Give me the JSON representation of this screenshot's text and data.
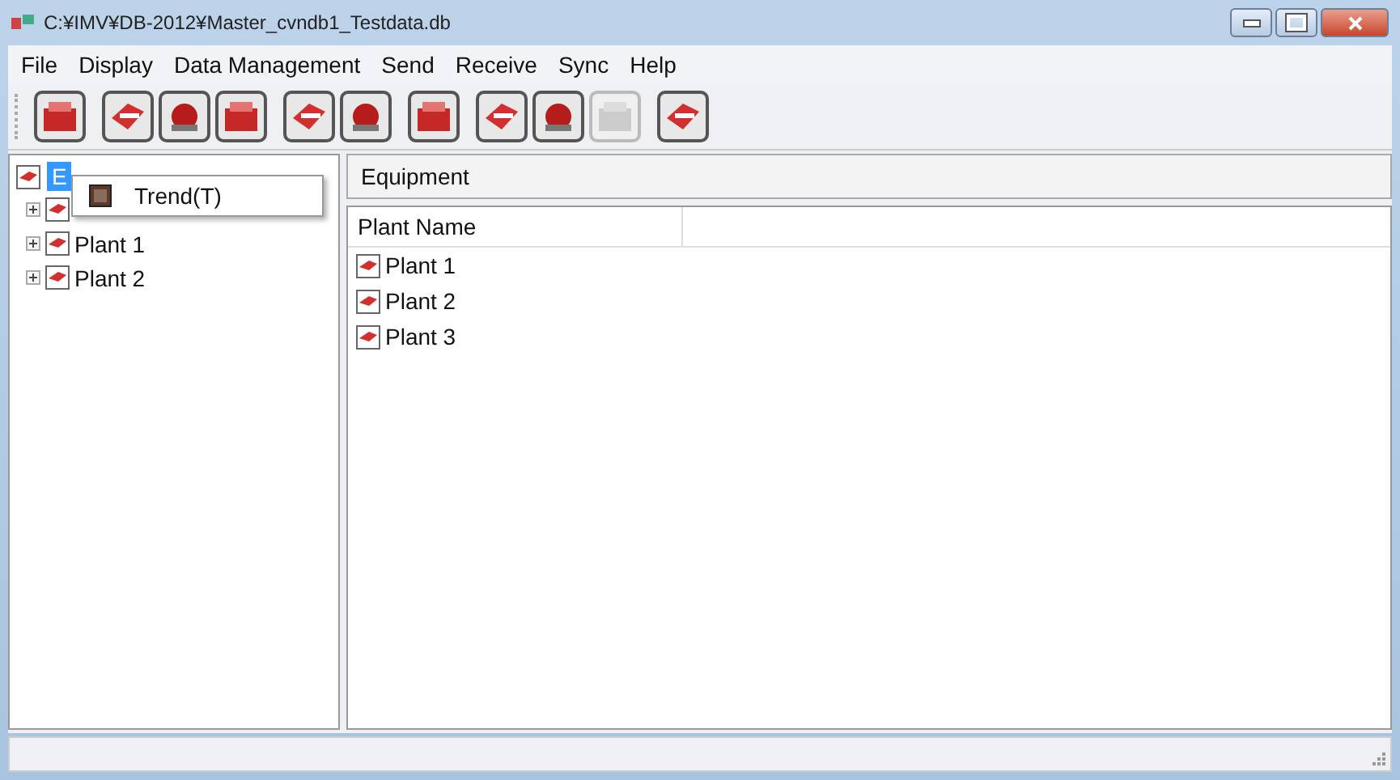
{
  "window": {
    "title": "C:¥IMV¥DB-2012¥Master_cvndb1_Testdata.db"
  },
  "menu": [
    "File",
    "Display",
    "Data Management",
    "Send",
    "Receive",
    "Sync",
    "Help"
  ],
  "toolbar": [
    {
      "disabled": false
    },
    {
      "disabled": false
    },
    {
      "disabled": false
    },
    {
      "disabled": false
    },
    {
      "disabled": false
    },
    {
      "disabled": false
    },
    {
      "disabled": false
    },
    {
      "disabled": false
    },
    {
      "disabled": false
    },
    {
      "disabled": true
    },
    {
      "disabled": false
    }
  ],
  "tree": {
    "label": "E",
    "selected": true,
    "children": [
      {
        "expanded": false
      },
      {
        "label": "Plant 1",
        "expanded": false
      },
      {
        "label": "Plant 2",
        "expanded": false
      }
    ]
  },
  "context_menu": {
    "items": [
      "Trend(T)"
    ]
  },
  "panel": {
    "title": "Equipment"
  },
  "table": {
    "columns": [
      "Plant Name"
    ],
    "rows": [
      "Plant 1",
      "Plant 2",
      "Plant 3"
    ]
  }
}
